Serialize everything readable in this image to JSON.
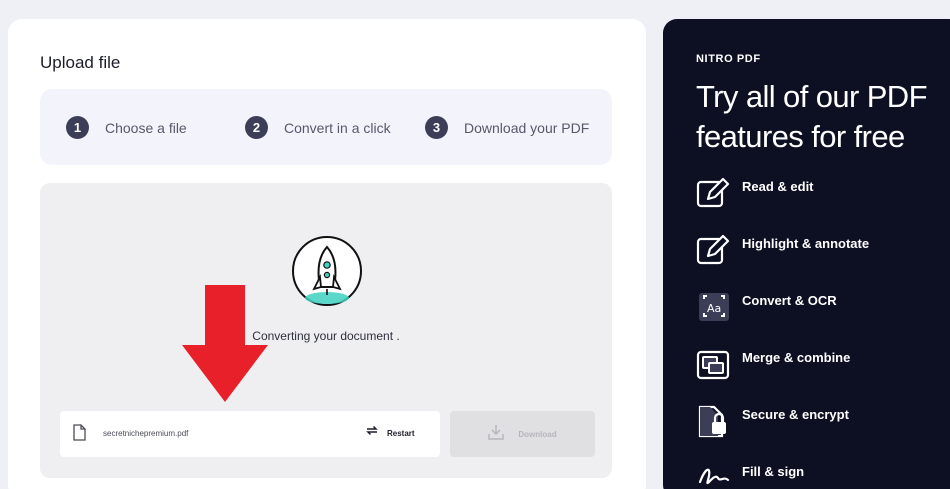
{
  "upload": {
    "title": "Upload file",
    "steps": [
      {
        "num": "1",
        "label": "Choose a file"
      },
      {
        "num": "2",
        "label": "Convert in a click"
      },
      {
        "num": "3",
        "label": "Download your PDF"
      }
    ],
    "status_text": "Converting your document  .",
    "file_name": "secretnichepremium.pdf",
    "restart_label": "Restart",
    "download_label": "Download"
  },
  "promo": {
    "brand": "NITRO PDF",
    "headline": "Try all of our PDF features for free",
    "features": [
      {
        "label": "Read & edit",
        "icon": "pencil-edit-icon"
      },
      {
        "label": "Highlight & annotate",
        "icon": "highlight-annotate-icon"
      },
      {
        "label": "Convert & OCR",
        "icon": "convert-ocr-icon"
      },
      {
        "label": "Merge & combine",
        "icon": "merge-combine-icon"
      },
      {
        "label": "Secure & encrypt",
        "icon": "lock-secure-icon"
      },
      {
        "label": "Fill & sign",
        "icon": "signature-icon"
      }
    ]
  },
  "colors": {
    "accent_arrow": "#e8202a",
    "rocket_teal": "#3fd1c1",
    "dark_panel": "#0d0f22"
  }
}
